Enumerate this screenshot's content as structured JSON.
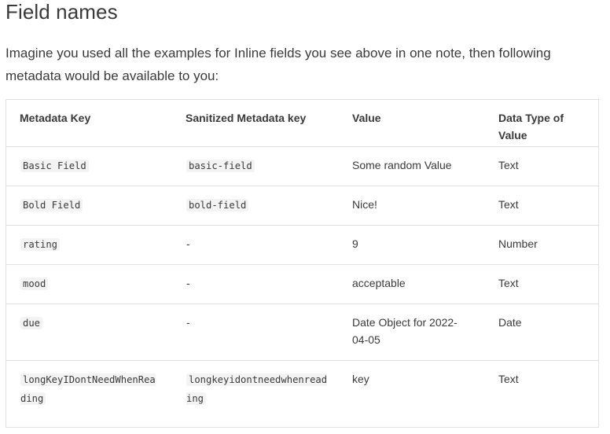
{
  "heading": "Field names",
  "intro": "Imagine you used all the examples for Inline fields you see above in one note, then following metadata would be available to you:",
  "table": {
    "headers": [
      "Metadata Key",
      "Sanitized Metadata key",
      "Value",
      "Data Type of Value"
    ],
    "rows": [
      {
        "key": "Basic Field",
        "sanitized": "basic-field",
        "value": "Some random Value",
        "type": "Text"
      },
      {
        "key": "Bold Field",
        "sanitized": "bold-field",
        "value": "Nice!",
        "type": "Text"
      },
      {
        "key": "rating",
        "sanitized": "-",
        "value": "9",
        "type": "Number"
      },
      {
        "key": "mood",
        "sanitized": "-",
        "value": "acceptable",
        "type": "Text"
      },
      {
        "key": "due",
        "sanitized": "-",
        "value": "Date Object for 2022-04-05",
        "type": "Date"
      },
      {
        "key": "longKeyIDontNeedWhenReading",
        "sanitized": "longkeyidontneedwhenreading",
        "value": "key",
        "type": "Text"
      }
    ]
  }
}
